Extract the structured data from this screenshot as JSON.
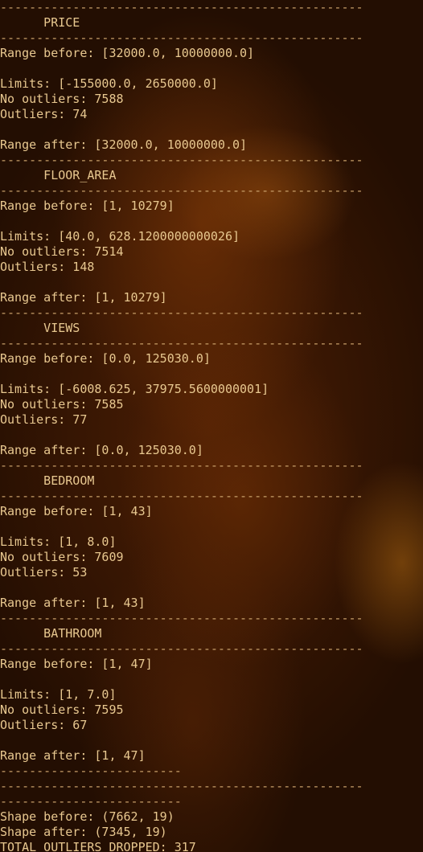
{
  "lines": [
    {
      "cls": "sep",
      "text": "--------------------------------------------------"
    },
    {
      "cls": "header",
      "text": "      PRICE"
    },
    {
      "cls": "sep",
      "text": "--------------------------------------------------"
    },
    {
      "cls": "",
      "text": "Range before: [32000.0, 10000000.0]"
    },
    {
      "cls": "",
      "text": ""
    },
    {
      "cls": "",
      "text": "Limits: [-155000.0, 2650000.0]"
    },
    {
      "cls": "",
      "text": "No outliers: 7588"
    },
    {
      "cls": "",
      "text": "Outliers: 74"
    },
    {
      "cls": "",
      "text": ""
    },
    {
      "cls": "",
      "text": "Range after: [32000.0, 10000000.0]"
    },
    {
      "cls": "sep",
      "text": "--------------------------------------------------"
    },
    {
      "cls": "header",
      "text": "      FLOOR_AREA"
    },
    {
      "cls": "sep",
      "text": "--------------------------------------------------"
    },
    {
      "cls": "",
      "text": "Range before: [1, 10279]"
    },
    {
      "cls": "",
      "text": ""
    },
    {
      "cls": "",
      "text": "Limits: [40.0, 628.1200000000026]"
    },
    {
      "cls": "",
      "text": "No outliers: 7514"
    },
    {
      "cls": "",
      "text": "Outliers: 148"
    },
    {
      "cls": "",
      "text": ""
    },
    {
      "cls": "",
      "text": "Range after: [1, 10279]"
    },
    {
      "cls": "sep",
      "text": "--------------------------------------------------"
    },
    {
      "cls": "header",
      "text": "      VIEWS"
    },
    {
      "cls": "sep",
      "text": "--------------------------------------------------"
    },
    {
      "cls": "",
      "text": "Range before: [0.0, 125030.0]"
    },
    {
      "cls": "",
      "text": ""
    },
    {
      "cls": "",
      "text": "Limits: [-6008.625, 37975.5600000001]"
    },
    {
      "cls": "",
      "text": "No outliers: 7585"
    },
    {
      "cls": "",
      "text": "Outliers: 77"
    },
    {
      "cls": "",
      "text": ""
    },
    {
      "cls": "",
      "text": "Range after: [0.0, 125030.0]"
    },
    {
      "cls": "sep",
      "text": "--------------------------------------------------"
    },
    {
      "cls": "header",
      "text": "      BEDROOM"
    },
    {
      "cls": "sep",
      "text": "--------------------------------------------------"
    },
    {
      "cls": "",
      "text": "Range before: [1, 43]"
    },
    {
      "cls": "",
      "text": ""
    },
    {
      "cls": "",
      "text": "Limits: [1, 8.0]"
    },
    {
      "cls": "",
      "text": "No outliers: 7609"
    },
    {
      "cls": "",
      "text": "Outliers: 53"
    },
    {
      "cls": "",
      "text": ""
    },
    {
      "cls": "",
      "text": "Range after: [1, 43]"
    },
    {
      "cls": "sep",
      "text": "--------------------------------------------------"
    },
    {
      "cls": "header",
      "text": "      BATHROOM"
    },
    {
      "cls": "sep",
      "text": "--------------------------------------------------"
    },
    {
      "cls": "",
      "text": "Range before: [1, 47]"
    },
    {
      "cls": "",
      "text": ""
    },
    {
      "cls": "",
      "text": "Limits: [1, 7.0]"
    },
    {
      "cls": "",
      "text": "No outliers: 7595"
    },
    {
      "cls": "",
      "text": "Outliers: 67"
    },
    {
      "cls": "",
      "text": ""
    },
    {
      "cls": "",
      "text": "Range after: [1, 47]"
    },
    {
      "cls": "sep",
      "text": "-------------------------"
    },
    {
      "cls": "sep",
      "text": "--------------------------------------------------"
    },
    {
      "cls": "sep",
      "text": "-------------------------"
    },
    {
      "cls": "",
      "text": "Shape before: (7662, 19)"
    },
    {
      "cls": "",
      "text": "Shape after: (7345, 19)"
    },
    {
      "cls": "",
      "text": "TOTAL OUTLIERS DROPPED: 317"
    }
  ]
}
